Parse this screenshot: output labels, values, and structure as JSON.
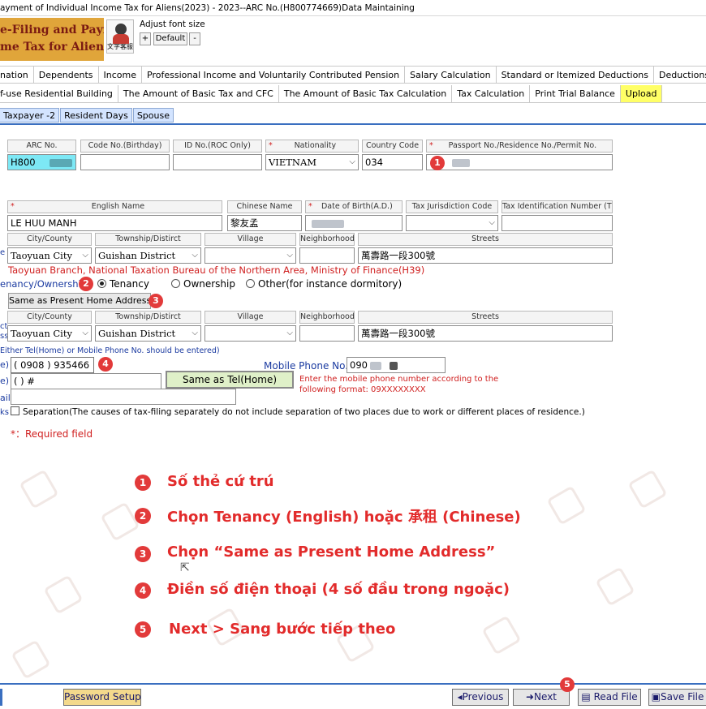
{
  "window": {
    "title": "ayment of Individual Income Tax for Aliens(2023) - 2023--ARC No.(H800774669)Data Maintaining"
  },
  "logo": {
    "line1": "e-Filing and Payment of",
    "line2": "me Tax for Aliens"
  },
  "mascot": {
    "caption": "文字客服"
  },
  "font_controls": {
    "label": "Adjust font size",
    "plus": "+",
    "default": "Default",
    "minus": "-"
  },
  "tabs_row1": [
    "nation",
    "Dependents",
    "Income",
    "Professional Income and Voluntarily Contributed Pension",
    "Salary Calculation",
    "Standard or Itemized Deductions",
    "Deductions and Basic"
  ],
  "tabs_row2": [
    "f-use Residential Building",
    "The Amount of Basic Tax and CFC",
    "The Amount of Basic Tax Calculation",
    "Tax Calculation",
    "Print Trial Balance",
    "Upload"
  ],
  "subtabs": [
    "Taxpayer -2",
    "Resident Days",
    "Spouse"
  ],
  "identity": {
    "arc_label": "ARC No.",
    "arc_value": "H800",
    "code_label": "Code No.(Birthday)",
    "id_label": "ID No.(ROC Only)",
    "nationality_label": "Nationality",
    "nationality_value": "VIETNAM",
    "country_code_label": "Country Code",
    "country_code_value": "034",
    "passport_label": "Passport No./Residence No./Permit No."
  },
  "person": {
    "english_name_label": "English Name",
    "english_name_value": "LE HUU MANH",
    "chinese_name_label": "Chinese Name",
    "chinese_name_value": "黎友孟",
    "dob_label": "Date of Birth(A.D.)",
    "tax_juris_label": "Tax Jurisdiction Code",
    "tin_label": "Tax Identification Number (TIN"
  },
  "address_headers": {
    "city": "City/County",
    "township": "Township/Distirct",
    "village": "Village",
    "neighborhood": "Neighborhood",
    "streets": "Streets"
  },
  "present_address": {
    "side_label": "e",
    "city": "Taoyuan City",
    "township": "Guishan District",
    "street": "萬壽路一段300號",
    "bureau": "Taoyuan Branch, National Taxation Bureau of the Northern Area, Ministry of Finance(H39)"
  },
  "ownership": {
    "label": "enancy/Ownership",
    "tenancy": "Tenancy",
    "ownership": "Ownership",
    "other": "Other(for instance dormitory)"
  },
  "same_address_button": "Same as Present Home Address",
  "domicile_address": {
    "side_label_1": "ct",
    "side_label_2": "ss",
    "city": "Taoyuan City",
    "township": "Guishan District",
    "street": "萬壽路一段300號"
  },
  "phone": {
    "hint": "Either Tel(Home) or Mobile Phone No. should be entered)",
    "home_side": "e)",
    "home_value": "( 0908 )   935466",
    "office_side": "e)",
    "office_value": "(        )              #",
    "same_tel_button": "Same as Tel(Home)",
    "mobile_label": "Mobile Phone No.",
    "mobile_value": "090",
    "mobile_note": "Enter the mobile phone number according to the following format: 09XXXXXXXX",
    "email_side": "ail",
    "remarks_side": "ks"
  },
  "separation": "Separation(The causes of tax-filing separately do not include separation of two places due to work or different places of residence.)",
  "required_note": "*：Required field",
  "annotations": [
    {
      "num": "1",
      "text": "Số thẻ cứ trú"
    },
    {
      "num": "2",
      "text": "Chọn Tenancy (English) hoặc 承租 (Chinese)"
    },
    {
      "num": "3",
      "text": "Chọn “Same as Present Home Address”"
    },
    {
      "num": "4",
      "text": "Điền số điện thoại (4 số đầu trong ngoặc)"
    },
    {
      "num": "5",
      "text": "Next > Sang bước tiếp theo"
    }
  ],
  "bottom": {
    "password": "Password Setup",
    "previous": "Previous",
    "next": "Next",
    "read_file": "Read File",
    "save_file": "Save File"
  },
  "colors": {
    "accent_red": "#e23a3a",
    "upload_tab": "#ffff66",
    "arc_highlight": "#7de8f5",
    "subtab": "#d3e4ff"
  }
}
